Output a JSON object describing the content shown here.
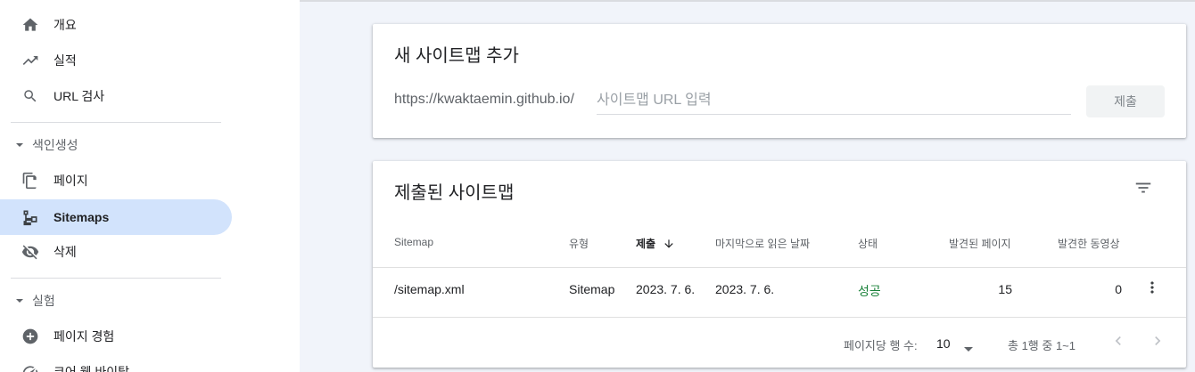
{
  "sidebar": {
    "items": [
      {
        "label": "개요",
        "icon": "home-icon"
      },
      {
        "label": "실적",
        "icon": "trending-up-icon"
      },
      {
        "label": "URL 검사",
        "icon": "search-icon"
      }
    ],
    "section_indexing": {
      "label": "색인생성",
      "items": [
        {
          "label": "페이지",
          "icon": "pages-icon"
        },
        {
          "label": "Sitemaps",
          "icon": "sitemap-icon",
          "active": true
        },
        {
          "label": "삭제",
          "icon": "visibility-off-icon"
        }
      ]
    },
    "section_experience": {
      "label": "실험",
      "items": [
        {
          "label": "페이지 경험",
          "icon": "add-circle-icon"
        },
        {
          "label": "코어 웹 바이탈",
          "icon": "speed-gauge-icon"
        }
      ]
    }
  },
  "add_card": {
    "title": "새 사이트맵 추가",
    "prefix": "https://kwaktaemin.github.io/",
    "input_value": "",
    "input_placeholder": "사이트맵 URL 입력",
    "submit_label": "제출"
  },
  "submitted_card": {
    "title": "제출된 사이트맵",
    "filter_icon": "filter-list-icon",
    "columns": {
      "sitemap": "Sitemap",
      "type": "유형",
      "submitted": "제출",
      "last_read": "마지막으로 읽은 날짜",
      "status": "상태",
      "discovered_pages": "발견된 페이지",
      "discovered_videos": "발견한 동영상"
    },
    "rows": [
      {
        "sitemap": "/sitemap.xml",
        "type": "Sitemap",
        "submitted": "2023. 7. 6.",
        "last_read": "2023. 7. 6.",
        "status": "성공",
        "discovered_pages": "15",
        "discovered_videos": "0"
      }
    ],
    "footer": {
      "rows_per_page_label": "페이지당 행 수:",
      "rows_per_page_value": "10",
      "range_text": "총 1행 중 1~1"
    }
  },
  "colors": {
    "active_nav_bg": "#d2e3fc",
    "status_success": "#188038",
    "main_bg": "#f1f4fa"
  }
}
